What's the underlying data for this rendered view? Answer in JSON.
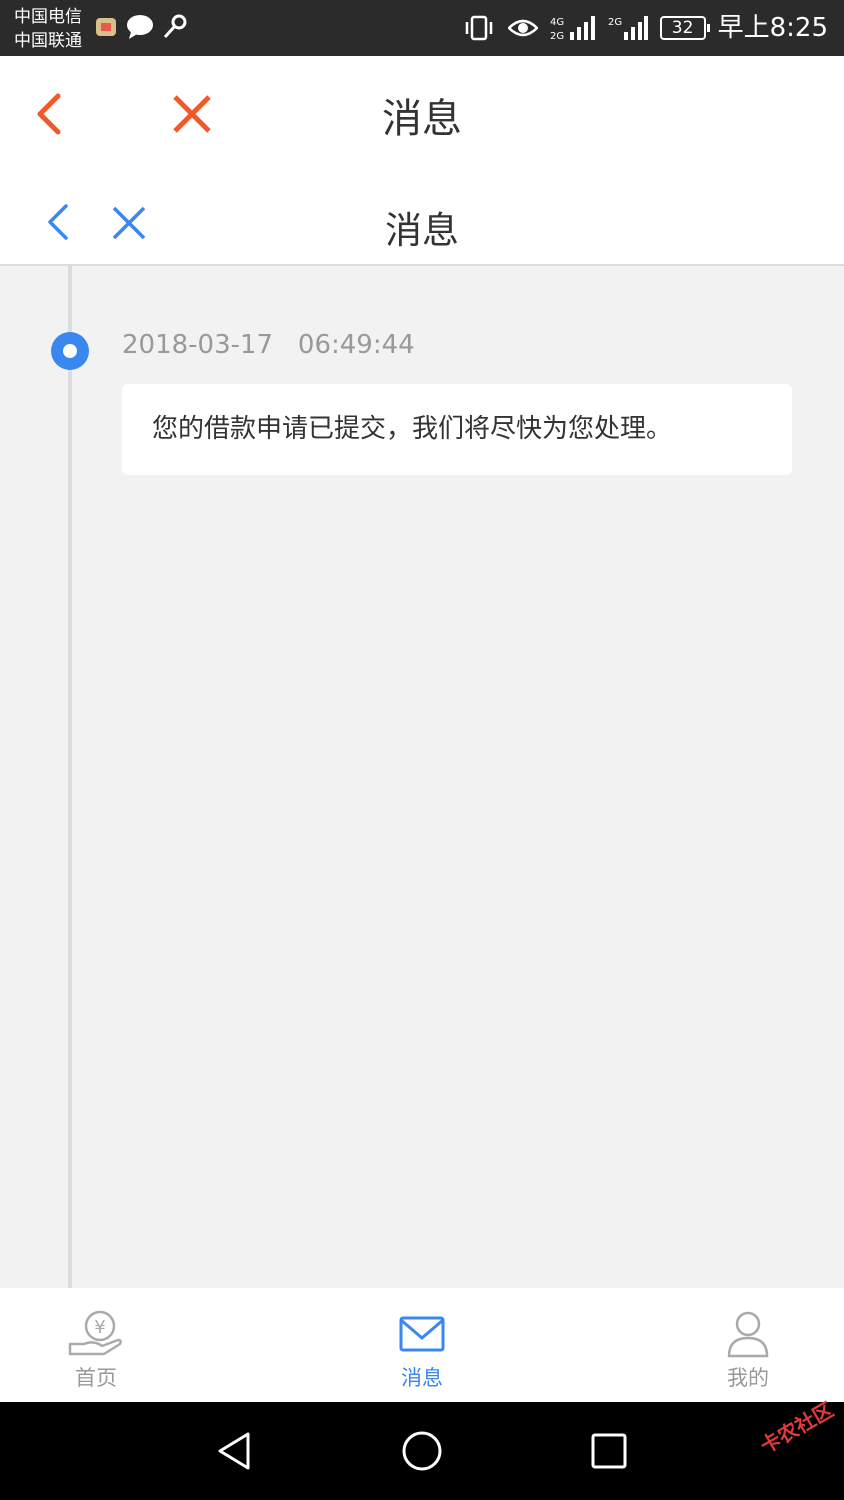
{
  "status_bar": {
    "carrier_1": "中国电信",
    "carrier_2": "中国联通",
    "battery": "32",
    "time": "早上8:25"
  },
  "outer_header": {
    "title": "消息",
    "accent_color": "#f05a2a"
  },
  "inner_header": {
    "title": "消息",
    "accent_color": "#3a87f0"
  },
  "messages": [
    {
      "date": "2018-03-17",
      "time": "06:49:44",
      "text": "您的借款申请已提交，我们将尽快为您处理。"
    }
  ],
  "tabs": [
    {
      "label": "首页",
      "icon": "home-money-hand-icon",
      "active": false
    },
    {
      "label": "消息",
      "icon": "mail-icon",
      "active": true
    },
    {
      "label": "我的",
      "icon": "person-icon",
      "active": false
    }
  ],
  "watermark": "卡农社区"
}
